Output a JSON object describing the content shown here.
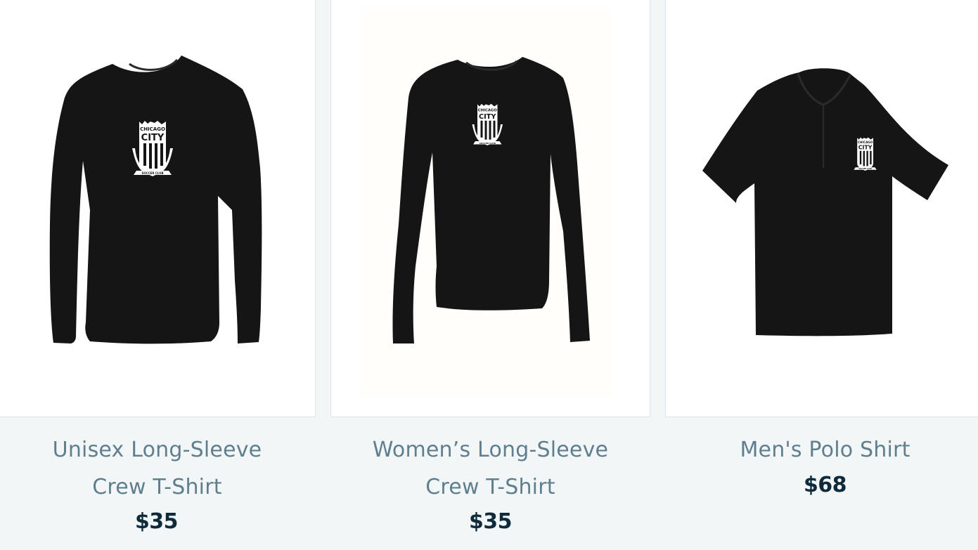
{
  "products": [
    {
      "title_line1": "Unisex Long-Sleeve",
      "title_line2": "Crew T-Shirt",
      "price": "$35",
      "image": "black-long-sleeve-tshirt-image",
      "logo_text_top": "CHICAGO",
      "logo_text_main": "CITY",
      "logo_text_banner": "SOCCER CLUB"
    },
    {
      "title_line1": "Women’s Long-Sleeve",
      "title_line2": "Crew T-Shirt",
      "price": "$35",
      "image": "black-womens-long-sleeve-image",
      "logo_text_top": "CHICAGO",
      "logo_text_main": "CITY",
      "logo_text_banner": "SOCCER CLUB"
    },
    {
      "title_line1": "Men's Polo Shirt",
      "title_line2": "",
      "price": "$68",
      "image": "black-polo-shirt-image",
      "logo_text_top": "CHICAGO",
      "logo_text_main": "CITY",
      "logo_text_banner": "SOCCER CLUB"
    }
  ],
  "colors": {
    "page_bg": "#f2f6f7",
    "title": "#5f7f8e",
    "price": "#0f2a3a",
    "garment": "#151515"
  }
}
